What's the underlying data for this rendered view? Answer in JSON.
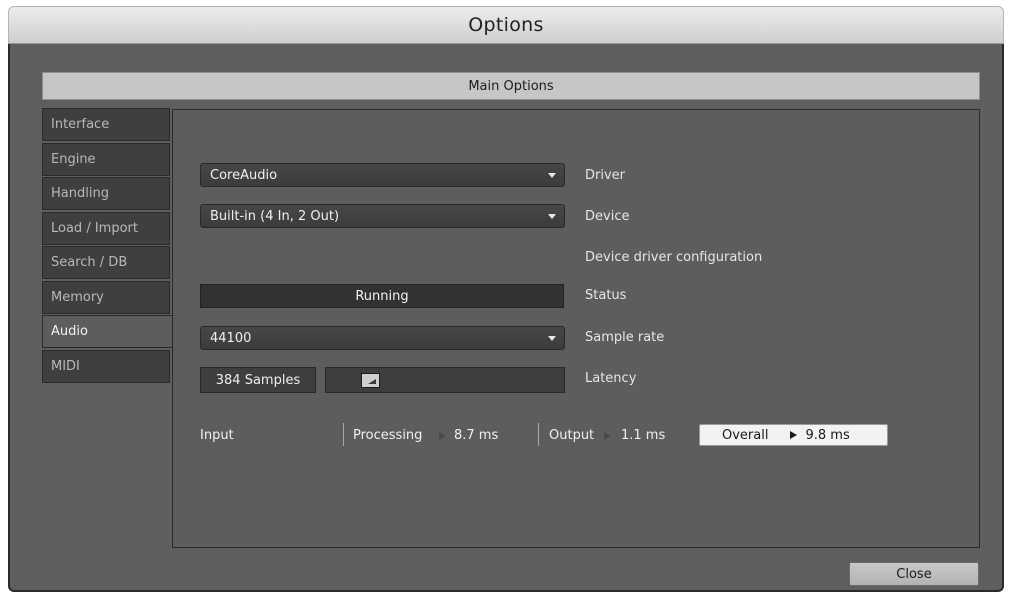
{
  "window": {
    "title": "Options"
  },
  "header": {
    "title": "Main Options"
  },
  "tabs": [
    {
      "label": "Interface"
    },
    {
      "label": "Engine"
    },
    {
      "label": "Handling"
    },
    {
      "label": "Load / Import"
    },
    {
      "label": "Search / DB"
    },
    {
      "label": "Memory"
    },
    {
      "label": "Audio"
    },
    {
      "label": "MIDI"
    }
  ],
  "active_tab": "Audio",
  "audio": {
    "driver": {
      "value": "CoreAudio",
      "label": "Driver"
    },
    "device": {
      "value": "Built-in (4 In, 2 Out)",
      "label": "Device"
    },
    "device_config_label": "Device driver configuration",
    "status": {
      "value": "Running",
      "label": "Status"
    },
    "sample_rate": {
      "value": "44100",
      "label": "Sample rate"
    },
    "latency": {
      "value": "384 Samples",
      "label": "Latency",
      "slider_fraction": 0.16
    },
    "timing": {
      "input_label": "Input",
      "processing_label": "Processing",
      "processing_value": "8.7 ms",
      "output_label": "Output",
      "output_value": "1.1 ms",
      "overall_label": "Overall",
      "overall_value": "9.8 ms"
    }
  },
  "buttons": {
    "close": "Close"
  }
}
